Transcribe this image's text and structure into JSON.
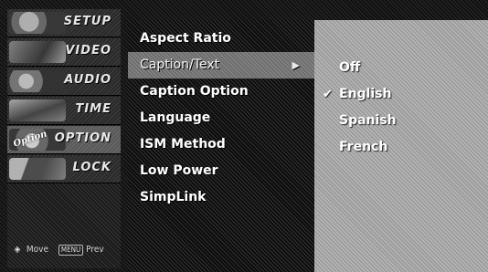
{
  "tabs": [
    {
      "label": "SETUP",
      "badge": ""
    },
    {
      "label": "VIDEO",
      "badge": ""
    },
    {
      "label": "AUDIO",
      "badge": ""
    },
    {
      "label": "TIME",
      "badge": ""
    },
    {
      "label": "OPTION",
      "badge": "Option"
    },
    {
      "label": "LOCK",
      "badge": ""
    }
  ],
  "active_tab": "OPTION",
  "hints": {
    "move_icon": "◈",
    "move_label": "Move",
    "menu_key": "MENU",
    "prev_label": "Prev"
  },
  "menu": {
    "items": [
      {
        "label": "Aspect Ratio",
        "has_submenu": false
      },
      {
        "label": "Caption/Text",
        "has_submenu": true,
        "arrow": "▶"
      },
      {
        "label": "Caption Option",
        "has_submenu": false
      },
      {
        "label": "Language",
        "has_submenu": false
      },
      {
        "label": "ISM Method",
        "has_submenu": false
      },
      {
        "label": "Low Power",
        "has_submenu": false
      },
      {
        "label": "SimpLink",
        "has_submenu": false
      }
    ],
    "selected": "Caption/Text"
  },
  "submenu": {
    "options": [
      {
        "label": "Off",
        "checked": false
      },
      {
        "label": "English",
        "checked": true,
        "check_mark": "✔"
      },
      {
        "label": "Spanish",
        "checked": false
      },
      {
        "label": "French",
        "checked": false
      }
    ]
  },
  "icons": [
    "move-icon",
    "menu-key-icon",
    "submenu-arrow-icon",
    "check-icon"
  ],
  "colors": {
    "selected_bg": "#6e6e6e",
    "submenu_bg": "#9c9c9c",
    "text": "#ffffff"
  }
}
